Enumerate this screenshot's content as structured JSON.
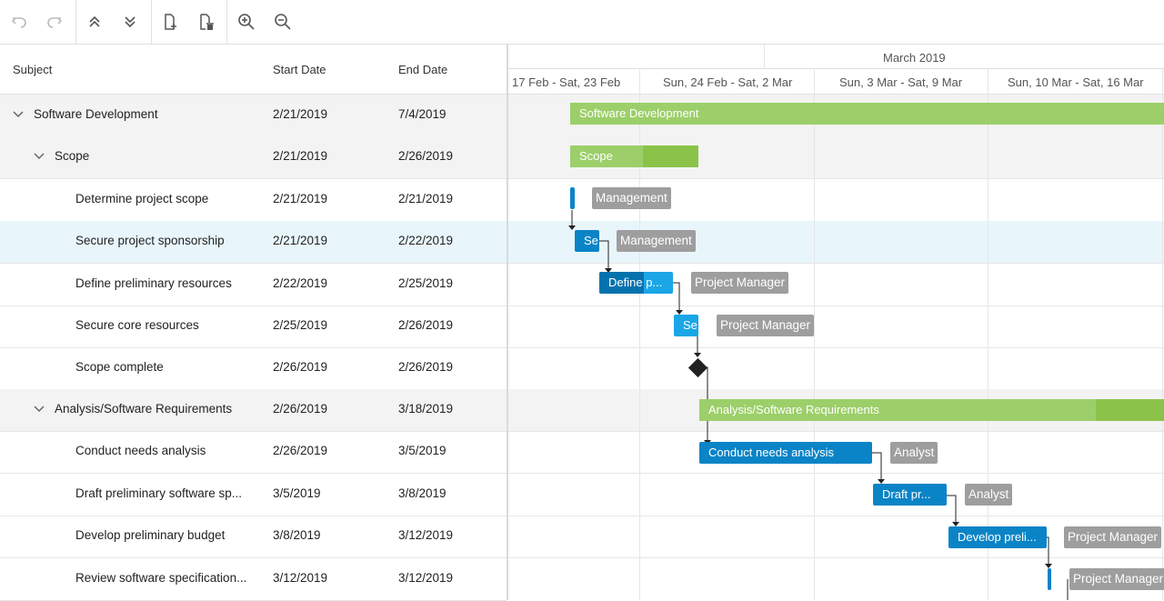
{
  "toolbar": {
    "buttons": [
      "undo-icon",
      "redo-icon",
      "collapse-all-icon",
      "expand-all-icon",
      "add-task-icon",
      "delete-task-icon",
      "zoom-in-icon",
      "zoom-out-icon"
    ]
  },
  "grid": {
    "columns": [
      "Subject",
      "Start Date",
      "End Date"
    ],
    "rows": [
      {
        "subject": "Software Development",
        "start": "2/21/2019",
        "end": "7/4/2019"
      },
      {
        "subject": "Scope",
        "start": "2/21/2019",
        "end": "2/26/2019"
      },
      {
        "subject": "Determine project scope",
        "start": "2/21/2019",
        "end": "2/21/2019"
      },
      {
        "subject": "Secure project sponsorship",
        "start": "2/21/2019",
        "end": "2/22/2019"
      },
      {
        "subject": "Define preliminary resources",
        "start": "2/22/2019",
        "end": "2/25/2019"
      },
      {
        "subject": "Secure core resources",
        "start": "2/25/2019",
        "end": "2/26/2019"
      },
      {
        "subject": "Scope complete",
        "start": "2/26/2019",
        "end": "2/26/2019"
      },
      {
        "subject": "Analysis/Software Requirements",
        "start": "2/26/2019",
        "end": "3/18/2019"
      },
      {
        "subject": "Conduct needs analysis",
        "start": "2/26/2019",
        "end": "3/5/2019"
      },
      {
        "subject": "Draft preliminary software sp...",
        "start": "3/5/2019",
        "end": "3/8/2019"
      },
      {
        "subject": "Develop preliminary budget",
        "start": "3/8/2019",
        "end": "3/12/2019"
      },
      {
        "subject": "Review software specification...",
        "start": "3/12/2019",
        "end": "3/12/2019"
      }
    ]
  },
  "scale": {
    "month": "March 2019",
    "weeks": [
      "17 Feb - Sat, 23 Feb",
      "Sun, 24 Feb - Sat, 2 Mar",
      "Sun, 3 Mar - Sat, 9 Mar",
      "Sun, 10 Mar - Sat, 16 Mar"
    ]
  },
  "bars": {
    "software_development": "Software Development",
    "scope": "Scope",
    "secure_sponsorship": "Se",
    "define_resources": "Define p...",
    "secure_core": "Se",
    "analysis": "Analysis/Software Requirements",
    "needs_analysis": "Conduct needs analysis",
    "draft": "Draft pr...",
    "budget": "Develop preli..."
  },
  "resources": {
    "r1": "Management",
    "r2": "Management",
    "r3": "Project Manager",
    "r4": "Project Manager",
    "r5": "Analyst",
    "r6": "Analyst",
    "r7": "Project Manager",
    "r8": "Project Manager"
  },
  "colors": {
    "task": "#0a84c6",
    "summary": "#9ccf69",
    "resource": "#9e9e9e",
    "selected_row": "#e8f6fc"
  }
}
